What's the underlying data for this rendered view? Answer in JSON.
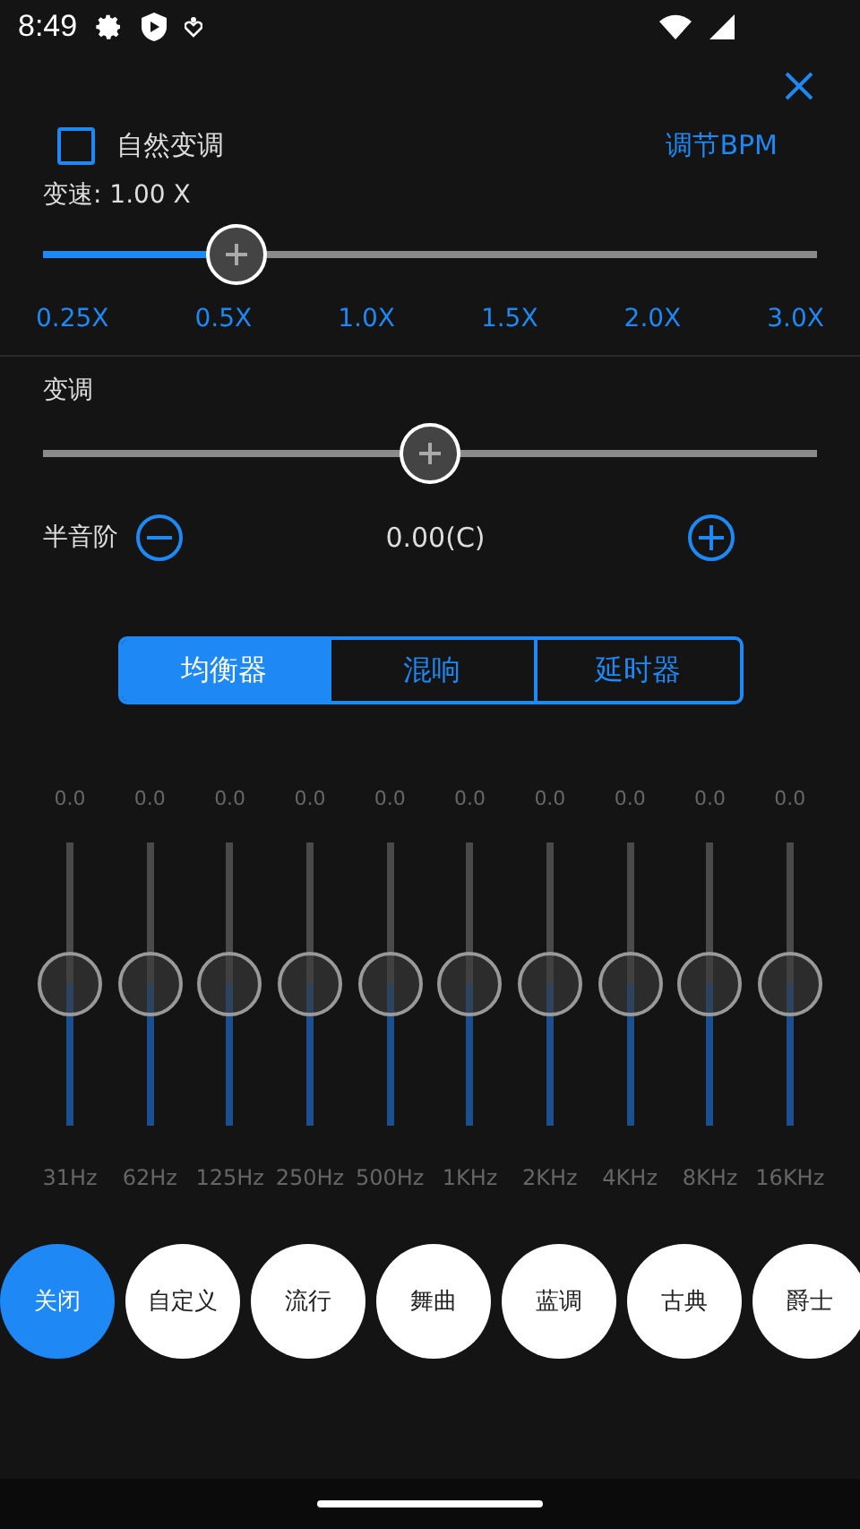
{
  "status_bar": {
    "time": "8:49"
  },
  "natural_pitch": {
    "label": "自然变调",
    "checked": false
  },
  "bpm_link": "调节BPM",
  "speed": {
    "label": "变速: 1.00 X",
    "level": 0.25,
    "ticks": [
      "0.25X",
      "0.5X",
      "1.0X",
      "1.5X",
      "2.0X",
      "3.0X"
    ]
  },
  "pitch": {
    "label": "变调",
    "level": 0.5
  },
  "semitone": {
    "label": "半音阶",
    "value": "0.00(C)"
  },
  "tabs": [
    {
      "label": "均衡器",
      "selected": true
    },
    {
      "label": "混响",
      "selected": false
    },
    {
      "label": "延时器",
      "selected": false
    }
  ],
  "bands": [
    {
      "value": "0.0",
      "freq": "31Hz",
      "level": 0.5
    },
    {
      "value": "0.0",
      "freq": "62Hz",
      "level": 0.5
    },
    {
      "value": "0.0",
      "freq": "125Hz",
      "level": 0.5
    },
    {
      "value": "0.0",
      "freq": "250Hz",
      "level": 0.5
    },
    {
      "value": "0.0",
      "freq": "500Hz",
      "level": 0.5
    },
    {
      "value": "0.0",
      "freq": "1KHz",
      "level": 0.5
    },
    {
      "value": "0.0",
      "freq": "2KHz",
      "level": 0.5
    },
    {
      "value": "0.0",
      "freq": "4KHz",
      "level": 0.5
    },
    {
      "value": "0.0",
      "freq": "8KHz",
      "level": 0.5
    },
    {
      "value": "0.0",
      "freq": "16KHz",
      "level": 0.5
    }
  ],
  "presets": [
    {
      "label": "关闭",
      "selected": true
    },
    {
      "label": "自定义",
      "selected": false
    },
    {
      "label": "流行",
      "selected": false
    },
    {
      "label": "舞曲",
      "selected": false
    },
    {
      "label": "蓝调",
      "selected": false
    },
    {
      "label": "古典",
      "selected": false
    },
    {
      "label": "爵士",
      "selected": false
    }
  ]
}
